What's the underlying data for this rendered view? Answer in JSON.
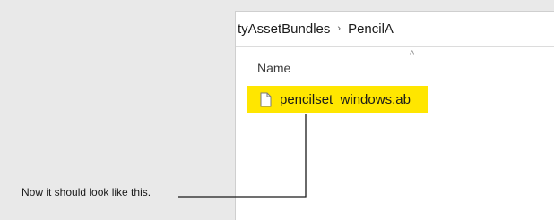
{
  "breadcrumb": {
    "segments": [
      "tyAssetBundles",
      "PencilA"
    ],
    "separator": "›"
  },
  "file_list": {
    "column_header": "Name",
    "sort_indicator": "^",
    "files": [
      {
        "name": "pencilset_windows.ab",
        "icon": "file-icon",
        "highlight_color": "#ffe600"
      }
    ]
  },
  "annotation": {
    "text": "Now it should look like this."
  }
}
